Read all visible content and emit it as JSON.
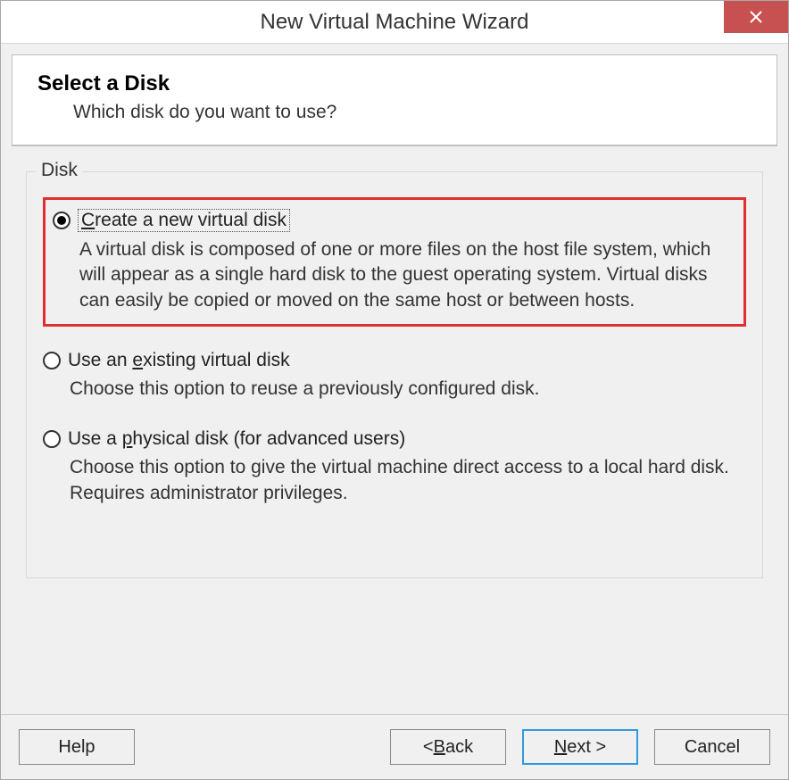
{
  "window": {
    "title": "New Virtual Machine Wizard"
  },
  "header": {
    "title": "Select a Disk",
    "subtitle": "Which disk do you want to use?"
  },
  "group": {
    "label": "Disk",
    "options": [
      {
        "label_pre": "",
        "mnemonic": "C",
        "label_post": "reate a new virtual disk",
        "description": "A virtual disk is composed of one or more files on the host file system, which will appear as a single hard disk to the guest operating system. Virtual disks can easily be copied or moved on the same host or between hosts.",
        "selected": true,
        "highlighted": true
      },
      {
        "label_pre": "Use an ",
        "mnemonic": "e",
        "label_post": "xisting virtual disk",
        "description": "Choose this option to reuse a previously configured disk.",
        "selected": false,
        "highlighted": false
      },
      {
        "label_pre": "Use a ",
        "mnemonic": "p",
        "label_post": "hysical disk (for advanced users)",
        "description": "Choose this option to give the virtual machine direct access to a local hard disk. Requires administrator privileges.",
        "selected": false,
        "highlighted": false
      }
    ]
  },
  "buttons": {
    "help": "Help",
    "back_pre": "< ",
    "back_mn": "B",
    "back_post": "ack",
    "next_pre": "",
    "next_mn": "N",
    "next_post": "ext >",
    "cancel": "Cancel"
  }
}
